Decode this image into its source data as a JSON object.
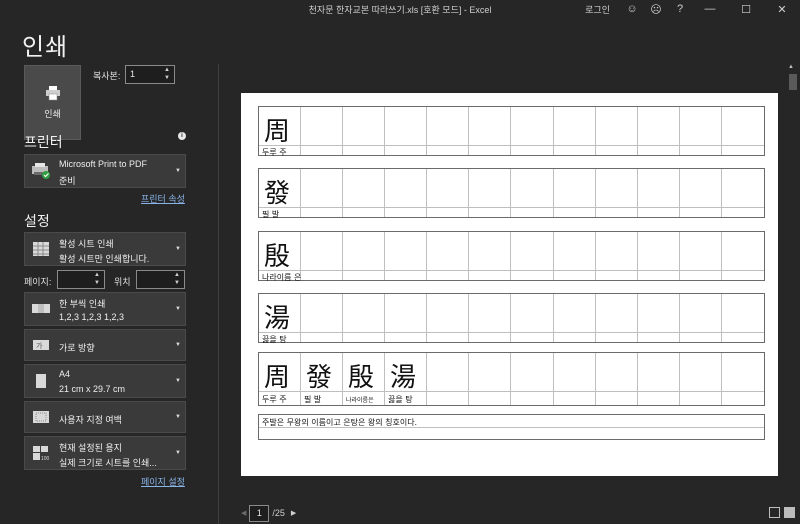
{
  "titlebar": {
    "title": "천자문 한자교본 따라쓰기.xls [호환 모드] - Excel",
    "login": "로그인"
  },
  "page_title": "인쇄",
  "print_button": {
    "label": "인쇄"
  },
  "copies": {
    "label": "복사본:",
    "value": "1"
  },
  "printer": {
    "section": "프린터",
    "name": "Microsoft Print to PDF",
    "status": "준비",
    "properties_link": "프린터 속성"
  },
  "settings": {
    "section": "설정",
    "what": {
      "line1": "활성 시트 인쇄",
      "line2": "활성 시트만 인쇄합니다."
    },
    "pages_label": "페이지:",
    "to_label": "위치",
    "pages_from": "",
    "pages_to": "",
    "collate": {
      "line1": "한 부씩 인쇄",
      "line2": "1,2,3    1,2,3    1,2,3"
    },
    "orientation": {
      "line1": "가로 방향"
    },
    "paper": {
      "line1": "A4",
      "line2": "21 cm x 29.7 cm"
    },
    "margins": {
      "line1": "사용자 지정 여백"
    },
    "scaling": {
      "line1": "현재 설정된 용지",
      "line2": "실제 크기로 시트를 인쇄..."
    },
    "page_setup_link": "페이지 설정"
  },
  "preview": {
    "rows": [
      {
        "hanja": "周",
        "reading": "두루 주"
      },
      {
        "hanja": "發",
        "reading": "필 발"
      },
      {
        "hanja": "殷",
        "reading": "나라이름 은"
      },
      {
        "hanja": "湯",
        "reading": "끓을 탕"
      }
    ],
    "combined": [
      {
        "hanja": "周",
        "reading": "두루 주"
      },
      {
        "hanja": "發",
        "reading": "필 발"
      },
      {
        "hanja": "殷",
        "reading": "나라이름은"
      },
      {
        "hanja": "湯",
        "reading": "끓을 탕"
      }
    ],
    "sentence": "주발은 무왕의 이름이고 은탕은 왕의 칭호이다."
  },
  "nav": {
    "current_page": "1",
    "total": "/25"
  }
}
